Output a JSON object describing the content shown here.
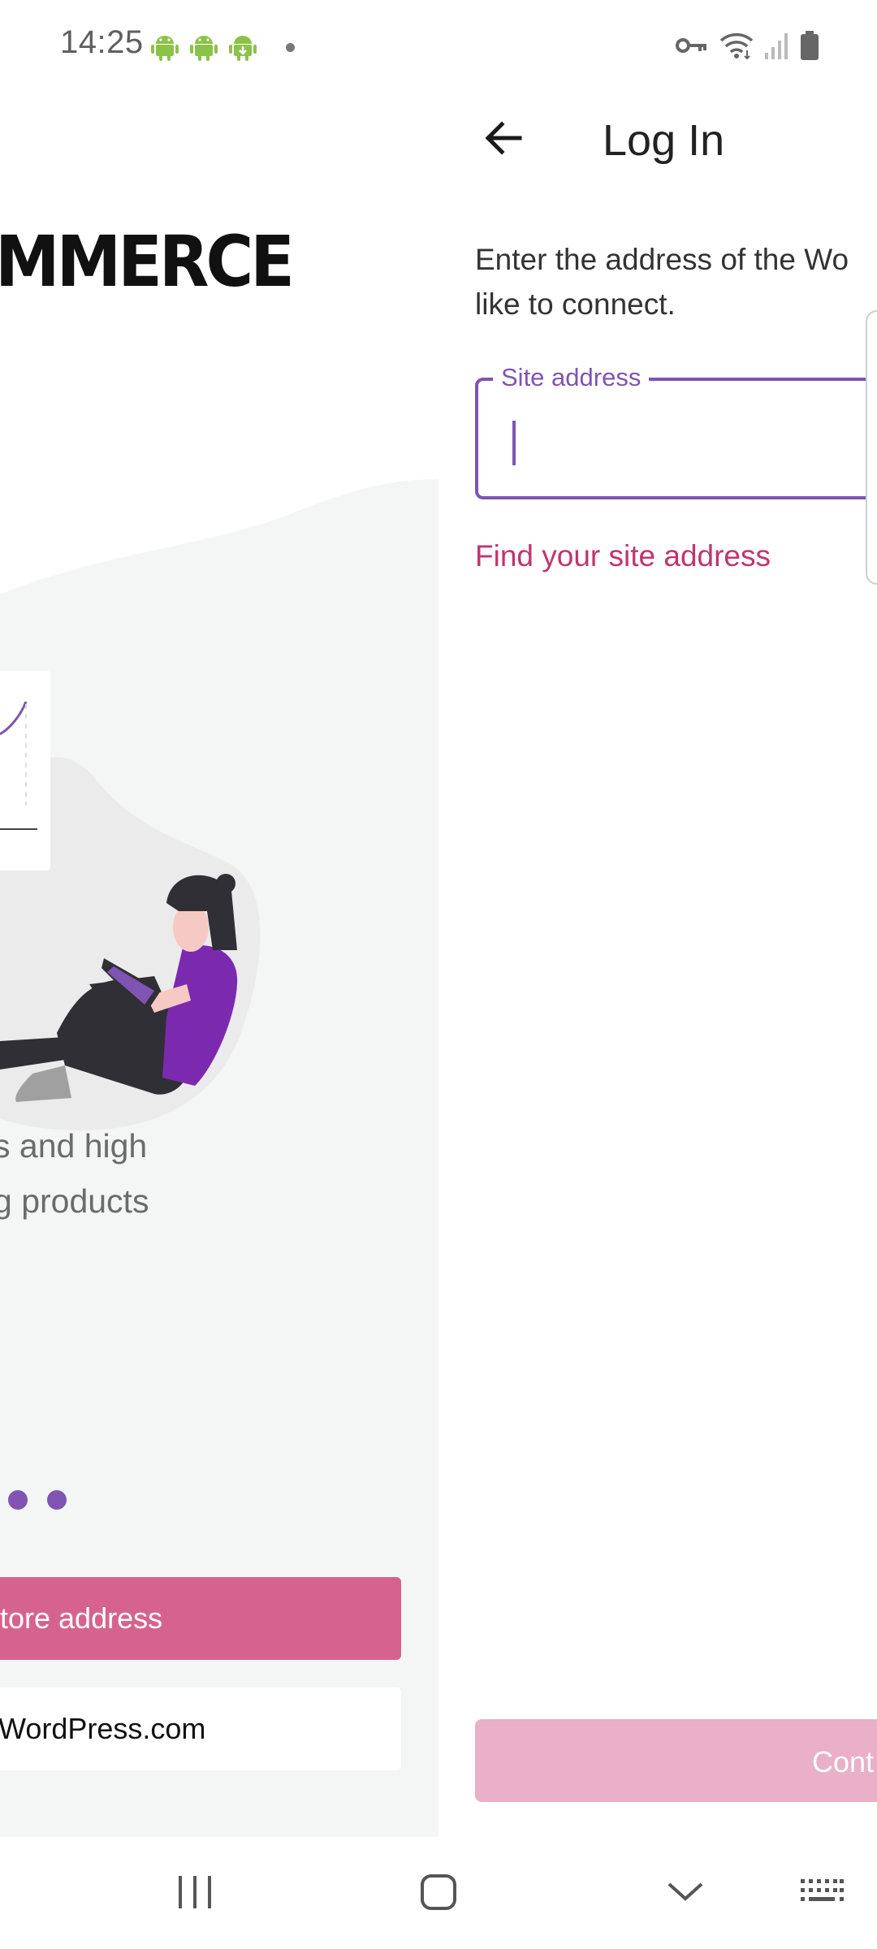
{
  "status_bar": {
    "time": "14:25",
    "left_icons": [
      "android-icon",
      "android-icon",
      "android-update-icon",
      "dot-icon"
    ],
    "right_icons": [
      "vpn-key-icon",
      "wifi-icon",
      "cell-signal-icon",
      "battery-icon"
    ]
  },
  "previous_screen": {
    "logo_text": "OMMERCE",
    "subtitle_lines": [
      "s and high",
      "g products"
    ],
    "pager_dot_count": 2,
    "primary_button_label": "tore address",
    "secondary_button_label": "WordPress.com"
  },
  "login_screen": {
    "title": "Log In",
    "instructions_line1": "Enter the address of the Wo",
    "instructions_line2": "like to connect.",
    "site_input": {
      "label": "Site address",
      "value": ""
    },
    "find_site_link": "Find your site address",
    "continue_button_label": "Cont"
  },
  "nav_bar": {
    "items": [
      "recents-icon",
      "home-icon",
      "hide-keyboard-icon",
      "keyboard-icon"
    ]
  },
  "colors": {
    "accent_purple": "#7f54b3",
    "link_pink": "#c0356f",
    "primary_pink": "#d6638e",
    "disabled_pink": "#e9b0c7"
  }
}
